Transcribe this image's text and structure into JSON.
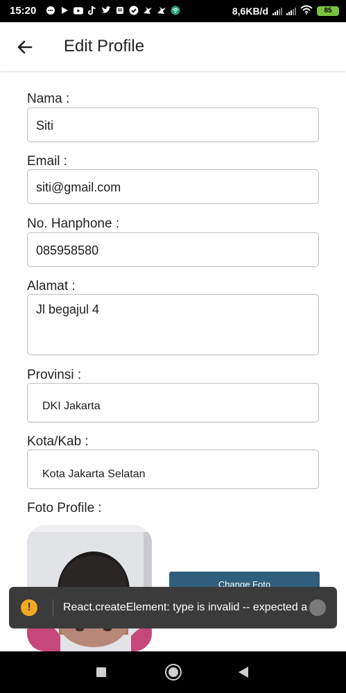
{
  "status_bar": {
    "time": "15:20",
    "net_speed": "8,6KB/d",
    "battery": "85",
    "notification_icons": [
      "chat-icon",
      "play-icon",
      "youtube-icon",
      "tiktok-icon",
      "twitter-icon",
      "news-icon",
      "check-icon",
      "bird-icon",
      "bird-icon",
      "vpn-icon"
    ]
  },
  "app_bar": {
    "title": "Edit Profile"
  },
  "form": {
    "nama_label": "Nama :",
    "nama_value": "Siti",
    "email_label": "Email :",
    "email_value": "siti@gmail.com",
    "phone_label": "No. Hanphone :",
    "phone_value": "085958580",
    "alamat_label": "Alamat :",
    "alamat_value": "Jl begajul 4",
    "provinsi_label": "Provinsi :",
    "provinsi_value": "DKI Jakarta",
    "kota_label": "Kota/Kab :",
    "kota_value": "Kota Jakarta Selatan",
    "foto_label": "Foto Profile :",
    "change_foto_label": "Change Foto"
  },
  "toast": {
    "message": "React.createElement: type is invalid -- expected a s..."
  },
  "colors": {
    "primary_button": "#2f5f7c",
    "toast_bg": "#3b3b3b",
    "warning": "#f2a825",
    "battery": "#7cc242"
  }
}
